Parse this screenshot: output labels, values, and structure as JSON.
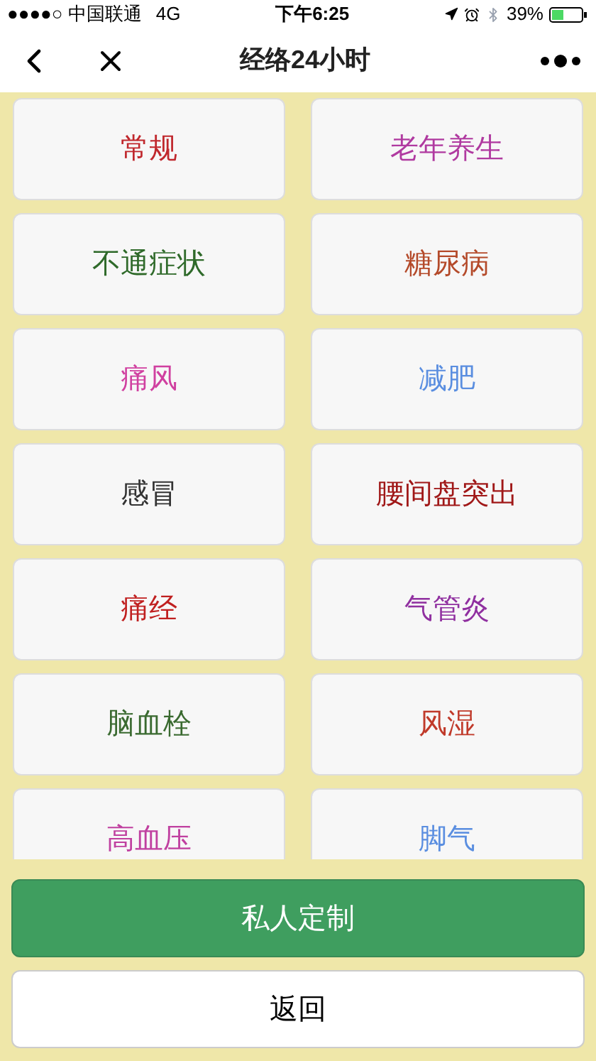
{
  "status_bar": {
    "carrier": "●●●●○ 中国联通",
    "network": "4G",
    "time": "下午6:25",
    "battery": "39%"
  },
  "nav": {
    "title": "经络24小时"
  },
  "items": [
    {
      "label": "常规",
      "color": "#c0282d"
    },
    {
      "label": "老年养生",
      "color": "#b03aa0"
    },
    {
      "label": "不通症状",
      "color": "#2f6a2a"
    },
    {
      "label": "糖尿病",
      "color": "#b44a2a"
    },
    {
      "label": "痛风",
      "color": "#d040a0"
    },
    {
      "label": "减肥",
      "color": "#5a8ee0"
    },
    {
      "label": "感冒",
      "color": "#333333"
    },
    {
      "label": "腰间盘突出",
      "color": "#a01818"
    },
    {
      "label": "痛经",
      "color": "#c02020"
    },
    {
      "label": "气管炎",
      "color": "#9030a0"
    },
    {
      "label": "脑血栓",
      "color": "#3a6a30"
    },
    {
      "label": "风湿",
      "color": "#c03a2a"
    },
    {
      "label": "高血压",
      "color": "#c040a0"
    },
    {
      "label": "脚气",
      "color": "#5a8ee0"
    }
  ],
  "buttons": [
    {
      "label": "私人定制",
      "kind": "primary"
    },
    {
      "label": "返回",
      "kind": "secondary"
    }
  ]
}
